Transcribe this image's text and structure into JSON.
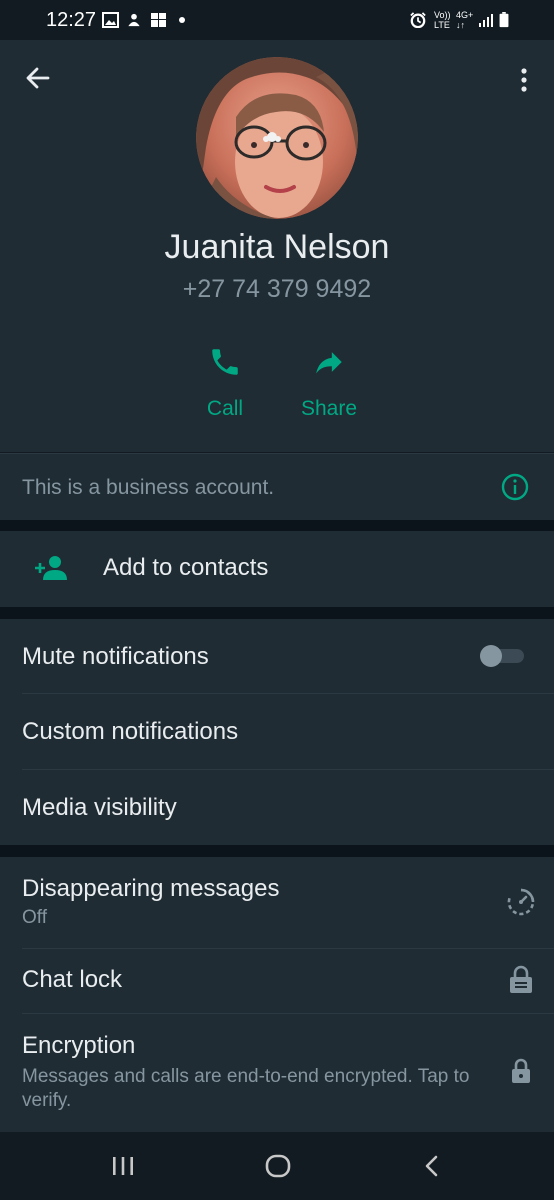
{
  "status_bar": {
    "time": "12:27",
    "left_icons": [
      "gallery-icon",
      "upload-icon",
      "windows-icon",
      "dot-icon"
    ],
    "right_icons": [
      "alarm-icon",
      "volte-icon",
      "4g-icon",
      "signal-icon",
      "battery-icon"
    ],
    "volte_line1": "Vo))",
    "volte_line2": "LTE",
    "net_label": "4G+"
  },
  "contact": {
    "name": "Juanita Nelson",
    "phone": "+27 74 379 9492"
  },
  "actions": [
    {
      "label": "Call",
      "icon": "phone-icon"
    },
    {
      "label": "Share",
      "icon": "share-icon"
    }
  ],
  "business_notice": {
    "text": "This is a business account.",
    "icon": "info-icon"
  },
  "add_contact": {
    "label": "Add to contacts",
    "icon": "add-person-icon"
  },
  "notifications": {
    "mute_label": "Mute notifications",
    "mute_on": false,
    "custom_label": "Custom notifications",
    "media_label": "Media visibility"
  },
  "privacy": {
    "disappearing_label": "Disappearing messages",
    "disappearing_value": "Off",
    "chat_lock_label": "Chat lock",
    "encryption_label": "Encryption",
    "encryption_sub": "Messages and calls are end-to-end encrypted. Tap to verify."
  },
  "colors": {
    "accent": "#00a884",
    "background": "#111b21",
    "surface": "#1f2c34",
    "secondary_text": "#8696a0"
  }
}
